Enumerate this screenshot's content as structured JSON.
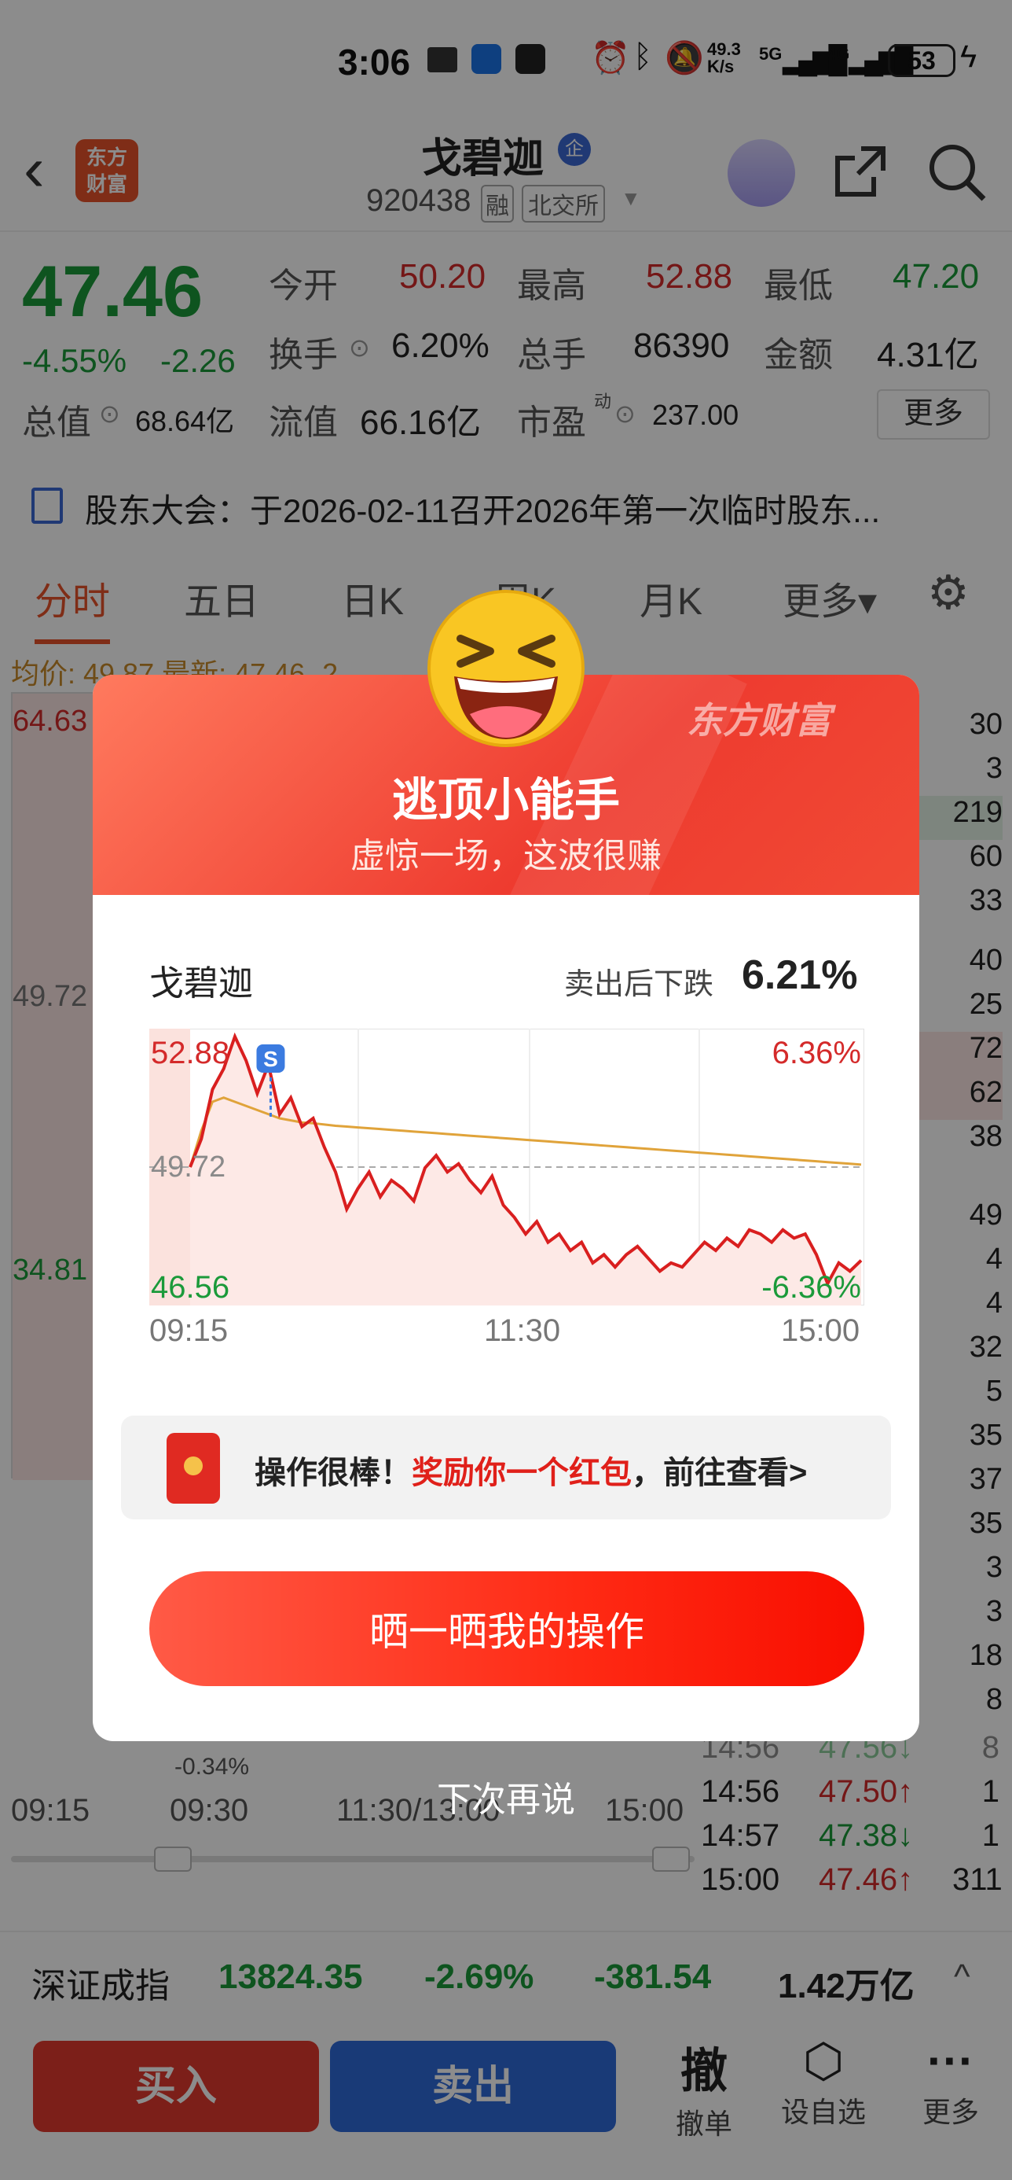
{
  "status": {
    "time": "3:06",
    "net_speed": "49.3\nK/s",
    "signal1": "5G",
    "signal2": "4G",
    "battery": "53"
  },
  "header": {
    "logo_line1": "东方",
    "logo_line2": "财富",
    "stock_name": "戈碧迦",
    "name_badge": "企",
    "code": "920438",
    "tag_margin": "融",
    "tag_exchange": "北交所"
  },
  "quote": {
    "price": "47.46",
    "change_pct": "-4.55%",
    "change_amt": "-2.26",
    "open_label": "今开",
    "open": "50.20",
    "high_label": "最高",
    "high": "52.88",
    "low_label": "最低",
    "low": "47.20",
    "turnover_label": "换手",
    "turnover": "6.20%",
    "volume_label": "总手",
    "volume": "86390",
    "amount_label": "金额",
    "amount": "4.31亿",
    "mktcap_label": "总值",
    "mktcap": "68.64亿",
    "float_label": "流值",
    "float_cap": "66.16亿",
    "pe_label": "市盈",
    "pe_sup": "动",
    "pe": "237.00",
    "more_button": "更多"
  },
  "notice": {
    "text": "股东大会：于2026-02-11召开2026年第一次临时股东..."
  },
  "tabs": [
    {
      "label": "分时"
    },
    {
      "label": "五日"
    },
    {
      "label": "日K"
    },
    {
      "label": "周K"
    },
    {
      "label": "月K"
    },
    {
      "label": "更多▾"
    }
  ],
  "chart_bg": {
    "avg_label": "均价: 49.87 最新: 47.46 -2",
    "max": "64.63",
    "mid": "49.72",
    "min": "34.81",
    "sub_min": "-0.34%",
    "times": [
      "09:15",
      "09:30",
      "11:30/13:00",
      "15:00"
    ],
    "side_numbers": [
      "30",
      "3",
      "219",
      "60",
      "33",
      "40",
      "25",
      "72",
      "62",
      "38",
      "49",
      "4",
      "4",
      "32",
      "5",
      "35",
      "37",
      "35",
      "3",
      "3",
      "18",
      "8"
    ],
    "trades": [
      {
        "time": "14:56",
        "price": "47.50↑",
        "vol": "1"
      },
      {
        "time": "14:57",
        "price": "47.38↓",
        "vol": "1"
      },
      {
        "time": "15:00",
        "price": "47.46↑",
        "vol": "311"
      }
    ],
    "trade_partial": {
      "time": "14:56",
      "price": "47.56↓",
      "vol": "8"
    }
  },
  "index_bar": {
    "name": "深证成指",
    "value": "13824.35",
    "pct": "-2.69%",
    "change": "-381.54",
    "turnover": "1.42万亿",
    "chevron": "^"
  },
  "bottom_bar": {
    "buy": "买入",
    "sell": "卖出",
    "cancel_icon": "撤",
    "cancel": "撤单",
    "watch": "设自选",
    "more": "更多"
  },
  "modal": {
    "watermark": "东方财富",
    "title": "逃顶小能手",
    "subtitle": "虚惊一场，这波很赚",
    "stock_name": "戈碧迦",
    "drop_label": "卖出后下跌",
    "drop_value": "6.21%",
    "sell_marker": "S",
    "reward_prefix": "操作很棒！",
    "reward_highlight": "奖励你一个红包",
    "reward_suffix": "，前往查看>",
    "share_button": "晒一晒我的操作",
    "dismiss": "下次再说"
  },
  "chart_data": {
    "type": "line",
    "title": "",
    "xlabel": "",
    "ylabel": "",
    "x_ticks": [
      "09:15",
      "11:30",
      "15:00"
    ],
    "y_labels": {
      "top_left": "52.88",
      "mid": "49.72",
      "bottom_left": "46.56",
      "top_right": "6.36%",
      "bottom_right": "-6.36%"
    },
    "ylim": [
      46.56,
      52.88
    ],
    "reference": 49.72,
    "sell_point": {
      "t": 0.12,
      "price": 51.7
    },
    "series": [
      {
        "values": [
          49.72,
          50.4,
          51.6,
          52.1,
          52.88,
          52.3,
          51.5,
          52.2,
          51.0,
          51.4,
          50.7,
          50.9,
          50.2,
          49.6,
          48.7,
          49.2,
          49.6,
          49.0,
          49.4,
          49.2,
          48.9,
          49.7,
          50.0,
          49.6,
          49.8,
          49.4,
          49.1,
          49.5,
          48.8,
          48.5,
          48.1,
          48.4,
          47.9,
          48.1,
          47.7,
          47.9,
          47.4,
          47.6,
          47.3,
          47.6,
          47.8,
          47.5,
          47.2,
          47.4,
          47.3,
          47.6,
          47.9,
          47.7,
          48.0,
          47.8,
          48.2,
          48.1,
          47.9,
          48.2,
          48.0,
          48.1,
          47.6,
          46.9,
          47.4,
          47.2,
          47.46
        ]
      },
      {
        "values": [
          49.72,
          50.6,
          51.3,
          51.4,
          51.3,
          51.2,
          51.1,
          51.0,
          50.9,
          50.85,
          50.8,
          50.78,
          50.75,
          50.72,
          50.7,
          50.68,
          50.66,
          50.64,
          50.62,
          50.6,
          50.58,
          50.56,
          50.54,
          50.52,
          50.5,
          50.48,
          50.46,
          50.44,
          50.42,
          50.4,
          50.38,
          50.36,
          50.34,
          50.32,
          50.3,
          50.28,
          50.26,
          50.24,
          50.22,
          50.2,
          50.18,
          50.16,
          50.14,
          50.12,
          50.1,
          50.08,
          50.06,
          50.04,
          50.02,
          50.0,
          49.98,
          49.96,
          49.94,
          49.92,
          49.9,
          49.88,
          49.86,
          49.84,
          49.82,
          49.8,
          49.78
        ]
      }
    ],
    "colors": {
      "price": "#d91f1f",
      "average": "#e0a33a",
      "fill": "#fde9e6"
    }
  }
}
